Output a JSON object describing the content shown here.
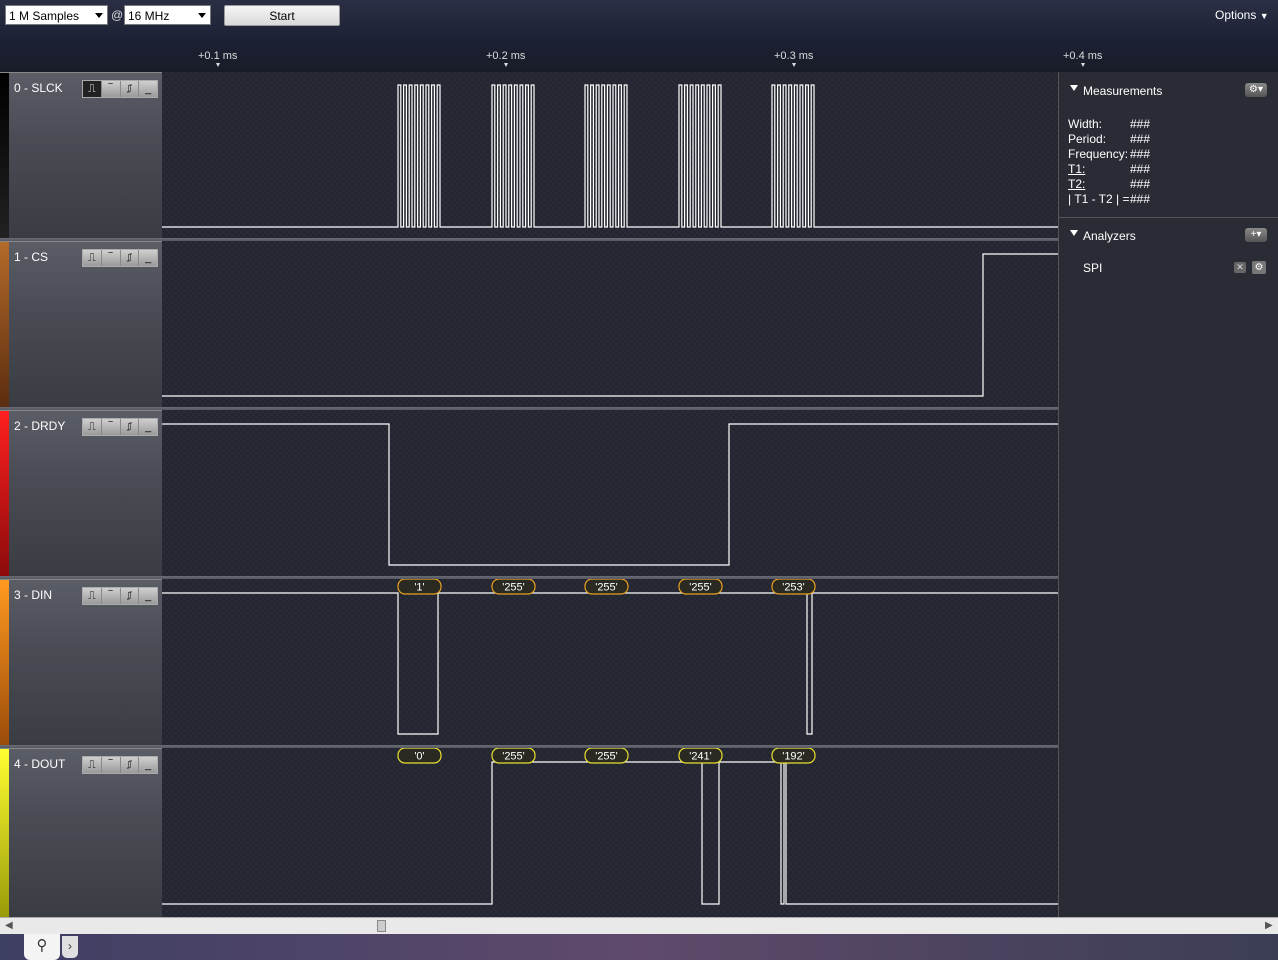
{
  "toolbar": {
    "samples": "1 M Samples",
    "at": "@",
    "rate": "16 MHz",
    "start_label": "Start",
    "options_label": "Options"
  },
  "timeline": {
    "ticks": [
      "+0.1 ms",
      "+0.2 ms",
      "+0.3 ms",
      "+0.4 ms"
    ]
  },
  "channels": [
    {
      "label": "0 - SLCK",
      "color": "#000000"
    },
    {
      "label": "1 - CS",
      "color": "#8a4a1a"
    },
    {
      "label": "2 - DRDY",
      "color": "#d81a1a"
    },
    {
      "label": "3 - DIN",
      "color": "#f08a1a"
    },
    {
      "label": "4 - DOUT",
      "color": "#e8e81a"
    }
  ],
  "decoded": {
    "din": [
      "'1'",
      "'255'",
      "'255'",
      "'255'",
      "'253'"
    ],
    "dout": [
      "'0'",
      "'255'",
      "'255'",
      "'241'",
      "'192'"
    ]
  },
  "measurements": {
    "title": "Measurements",
    "rows": [
      {
        "label": "Width:",
        "value": "###"
      },
      {
        "label": "Period:",
        "value": "###"
      },
      {
        "label": "Frequency:",
        "value": "###"
      },
      {
        "label": "T1:",
        "value": "###"
      },
      {
        "label": "T2:",
        "value": "###"
      },
      {
        "label": "| T1 - T2 | =",
        "value": "###"
      }
    ]
  },
  "analyzers": {
    "title": "Analyzers",
    "items": [
      "SPI"
    ]
  },
  "icons": {
    "rising_edge": "rising-edge-icon",
    "high": "high-level-icon",
    "falling_edge": "falling-edge-icon",
    "low": "low-level-icon"
  }
}
